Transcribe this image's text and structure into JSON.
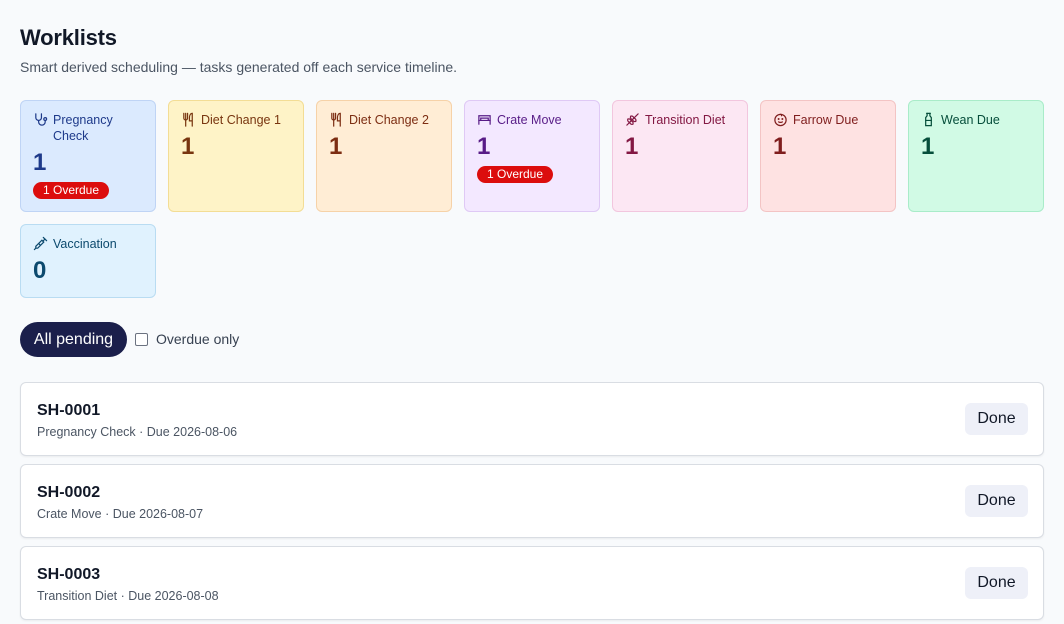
{
  "header": {
    "title": "Worklists",
    "subtitle": "Smart derived scheduling — tasks generated off each service timeline."
  },
  "cards": [
    {
      "label": "Pregnancy Check",
      "count": "1",
      "badge": "1 Overdue",
      "icon": "stethoscope-icon"
    },
    {
      "label": "Diet Change 1",
      "count": "1",
      "icon": "utensils-icon"
    },
    {
      "label": "Diet Change 2",
      "count": "1",
      "icon": "utensils-icon"
    },
    {
      "label": "Crate Move",
      "count": "1",
      "badge": "1 Overdue",
      "icon": "bed-icon"
    },
    {
      "label": "Transition Diet",
      "count": "1",
      "icon": "wheat-icon"
    },
    {
      "label": "Farrow Due",
      "count": "1",
      "icon": "baby-icon"
    },
    {
      "label": "Wean Due",
      "count": "1",
      "icon": "milk-bottle-icon"
    },
    {
      "label": "Vaccination",
      "count": "0",
      "icon": "syringe-icon"
    }
  ],
  "filters": {
    "all_pending": "All pending",
    "overdue_only": "Overdue only"
  },
  "tasks": [
    {
      "id": "SH-0001",
      "meta": "Pregnancy Check · Due 2026-08-06",
      "action": "Done"
    },
    {
      "id": "SH-0002",
      "meta": "Crate Move · Due 2026-08-07",
      "action": "Done"
    },
    {
      "id": "SH-0003",
      "meta": "Transition Diet · Due 2026-08-08",
      "action": "Done"
    }
  ],
  "colors": {
    "overdue_badge": "#dc0d0d",
    "primary_button": "#1b1f4b"
  }
}
